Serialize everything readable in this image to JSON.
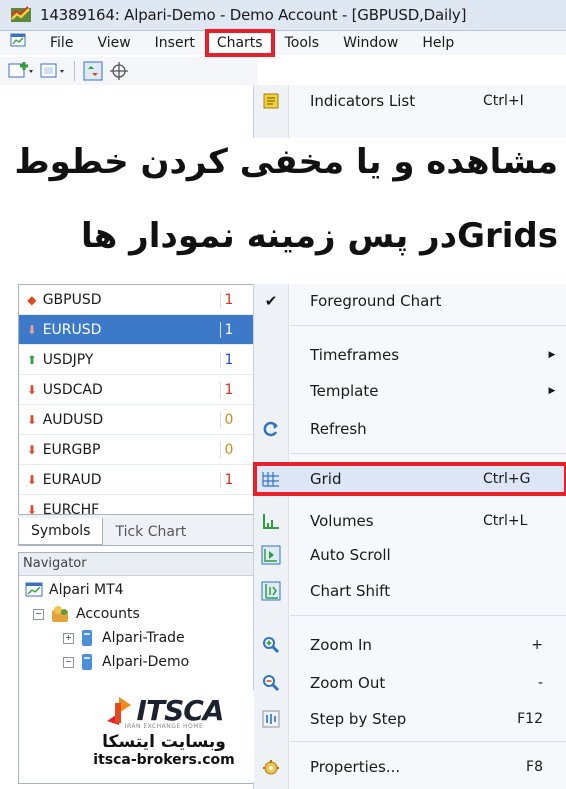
{
  "window": {
    "title": "14389164: Alpari-Demo - Demo Account - [GBPUSD,Daily]"
  },
  "menubar": {
    "items": [
      "File",
      "View",
      "Insert",
      "Charts",
      "Tools",
      "Window",
      "Help"
    ],
    "active": "Charts"
  },
  "caption": {
    "line1": "مشاهده و یا مخفی کردن خطوط",
    "line2": "Gridsدر پس زمینه نمودار ها"
  },
  "symbols": {
    "rows": [
      {
        "name": "GBPUSD",
        "value": "1",
        "dir": "down"
      },
      {
        "name": "EURUSD",
        "value": "1",
        "dir": "down",
        "selected": true
      },
      {
        "name": "USDJPY",
        "value": "1",
        "dir": "up"
      },
      {
        "name": "USDCAD",
        "value": "1",
        "dir": "down"
      },
      {
        "name": "AUDUSD",
        "value": "0",
        "dir": "down"
      },
      {
        "name": "EURGBP",
        "value": "0",
        "dir": "down"
      },
      {
        "name": "EURAUD",
        "value": "1",
        "dir": "down"
      },
      {
        "name": "EURCHF",
        "value": "",
        "dir": "down"
      }
    ],
    "tabs": [
      "Symbols",
      "Tick Chart"
    ]
  },
  "navigator": {
    "header": "Navigator",
    "root": "Alpari MT4",
    "accounts": "Accounts",
    "account_items": [
      "Alpari-Trade",
      "Alpari-Demo"
    ]
  },
  "logo": {
    "brand": "ITSCA",
    "tagline": "IRAN EXCHANGE HOME",
    "persian": "وبسایت ایتسکا",
    "url": "itsca-brokers.com"
  },
  "charts_menu": {
    "indicators": {
      "label": "Indicators List",
      "shortcut": "Ctrl+I"
    },
    "foreground": {
      "label": "Foreground Chart",
      "checked": true
    },
    "timeframes": {
      "label": "Timeframes"
    },
    "template": {
      "label": "Template"
    },
    "refresh": {
      "label": "Refresh"
    },
    "grid": {
      "label": "Grid",
      "shortcut": "Ctrl+G"
    },
    "volumes": {
      "label": "Volumes",
      "shortcut": "Ctrl+L"
    },
    "autoscroll": {
      "label": "Auto Scroll"
    },
    "chartshift": {
      "label": "Chart Shift"
    },
    "zoomin": {
      "label": "Zoom In",
      "shortcut": "+"
    },
    "zoomout": {
      "label": "Zoom Out",
      "shortcut": "-"
    },
    "step": {
      "label": "Step by Step",
      "shortcut": "F12"
    },
    "properties": {
      "label": "Properties...",
      "shortcut": "F8"
    }
  },
  "colors": {
    "highlight_red": "#e8202a",
    "selected_blue": "#3d79c9",
    "down_arrow": "#e0461f",
    "up_arrow": "#2e9e3b"
  }
}
